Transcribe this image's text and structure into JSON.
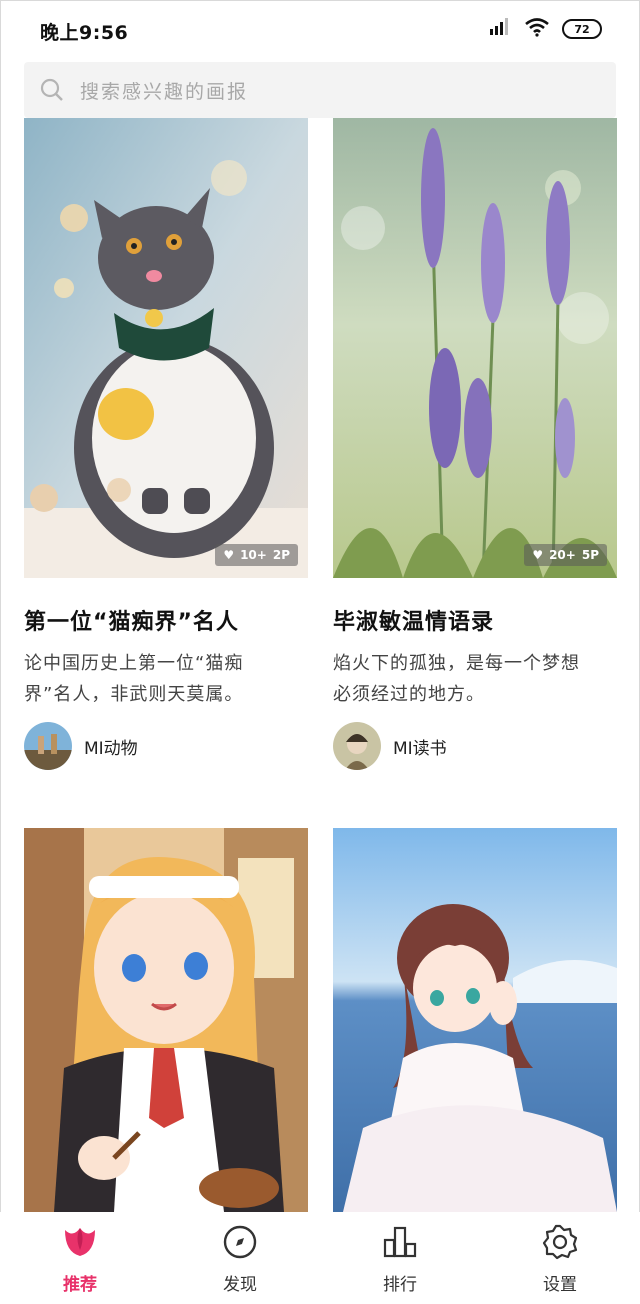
{
  "status_bar": {
    "time": "晚上9:56",
    "battery": "72"
  },
  "search": {
    "placeholder": "搜索感兴趣的画报"
  },
  "cards": [
    {
      "title": "第一位“猫痴界”名人",
      "description": "论中国历史上第一位“猫痴界”名人，非武则天莫属。",
      "likes": "10+",
      "pages": "2P",
      "author": "MI动物"
    },
    {
      "title": "毕淑敏温情语录",
      "description": "焰火下的孤独，是每一个梦想必须经过的地方。",
      "likes": "20+",
      "pages": "5P",
      "author": "MI读书"
    },
    {
      "title": "",
      "description": "",
      "likes": "",
      "pages": "",
      "author": ""
    },
    {
      "title": "",
      "description": "",
      "likes": "",
      "pages": "",
      "author": ""
    }
  ],
  "nav": [
    {
      "label": "推荐",
      "icon": "tulip-icon",
      "active": true
    },
    {
      "label": "发现",
      "icon": "compass-icon",
      "active": false
    },
    {
      "label": "排行",
      "icon": "bar-chart-icon",
      "active": false
    },
    {
      "label": "设置",
      "icon": "gear-icon",
      "active": false
    }
  ],
  "colors": {
    "accent": "#e8326a",
    "search_bg": "#f3f3f3"
  }
}
